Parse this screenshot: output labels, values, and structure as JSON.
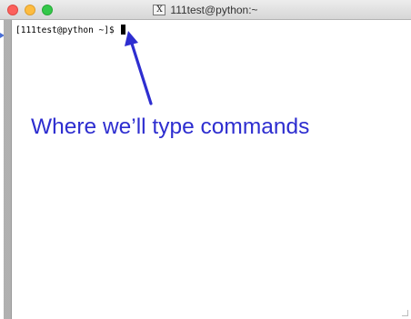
{
  "window": {
    "title": "111test@python:~",
    "title_icon": "X",
    "buttons": [
      "close",
      "minimize",
      "zoom"
    ]
  },
  "terminal": {
    "prompt": "[111test@python ~]$",
    "input_value": ""
  },
  "annotation": {
    "text": "Where we’ll type commands",
    "color": "#2e2ed0"
  },
  "colors": {
    "close": "#fc605c",
    "minimize": "#fdbc40",
    "zoom": "#34c84a",
    "accent": "#2e2ed0"
  },
  "icons": {
    "title": "x11-icon",
    "arrow": "arrow-icon",
    "pointer": "pointer-triangle-icon"
  }
}
